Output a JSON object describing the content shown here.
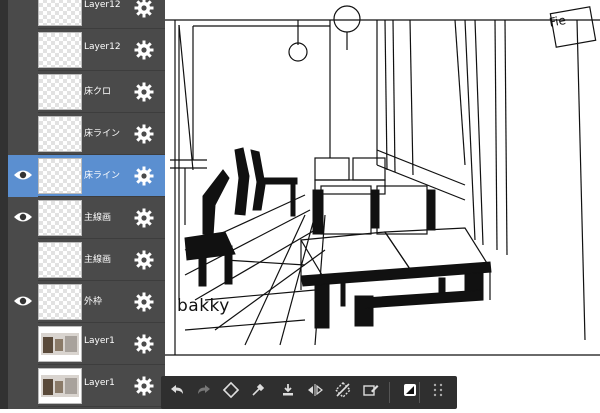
{
  "layers": [
    {
      "name": "Layer12",
      "visible": false,
      "selected": false,
      "thumb": "transparent"
    },
    {
      "name": "Layer12",
      "visible": false,
      "selected": false,
      "thumb": "transparent"
    },
    {
      "name": "床クロ",
      "visible": false,
      "selected": false,
      "thumb": "transparent"
    },
    {
      "name": "床ライン",
      "visible": false,
      "selected": false,
      "thumb": "transparent"
    },
    {
      "name": "床ライン",
      "visible": true,
      "selected": true,
      "thumb": "transparent"
    },
    {
      "name": "主線画",
      "visible": true,
      "selected": false,
      "thumb": "transparent"
    },
    {
      "name": "主線画",
      "visible": false,
      "selected": false,
      "thumb": "transparent"
    },
    {
      "name": "外枠",
      "visible": true,
      "selected": false,
      "thumb": "transparent"
    },
    {
      "name": "Layer1",
      "visible": false,
      "selected": false,
      "thumb": "photo"
    },
    {
      "name": "Layer1",
      "visible": false,
      "selected": false,
      "thumb": "photo"
    }
  ],
  "canvas": {
    "signature": "bakky",
    "sign_text": "Fie"
  },
  "toolbar": {
    "buttons": [
      "undo-icon",
      "redo-icon",
      "transform-icon",
      "eyedropper-icon",
      "import-icon",
      "flip-horizontal-icon",
      "hide-selection-icon",
      "edit-selection-icon",
      "color-swatch-icon",
      "more-grid-icon"
    ]
  },
  "colors": {
    "panel": "#4a4a4a",
    "selected": "#5b8fd0",
    "toolbar": "#2f2f2f"
  }
}
